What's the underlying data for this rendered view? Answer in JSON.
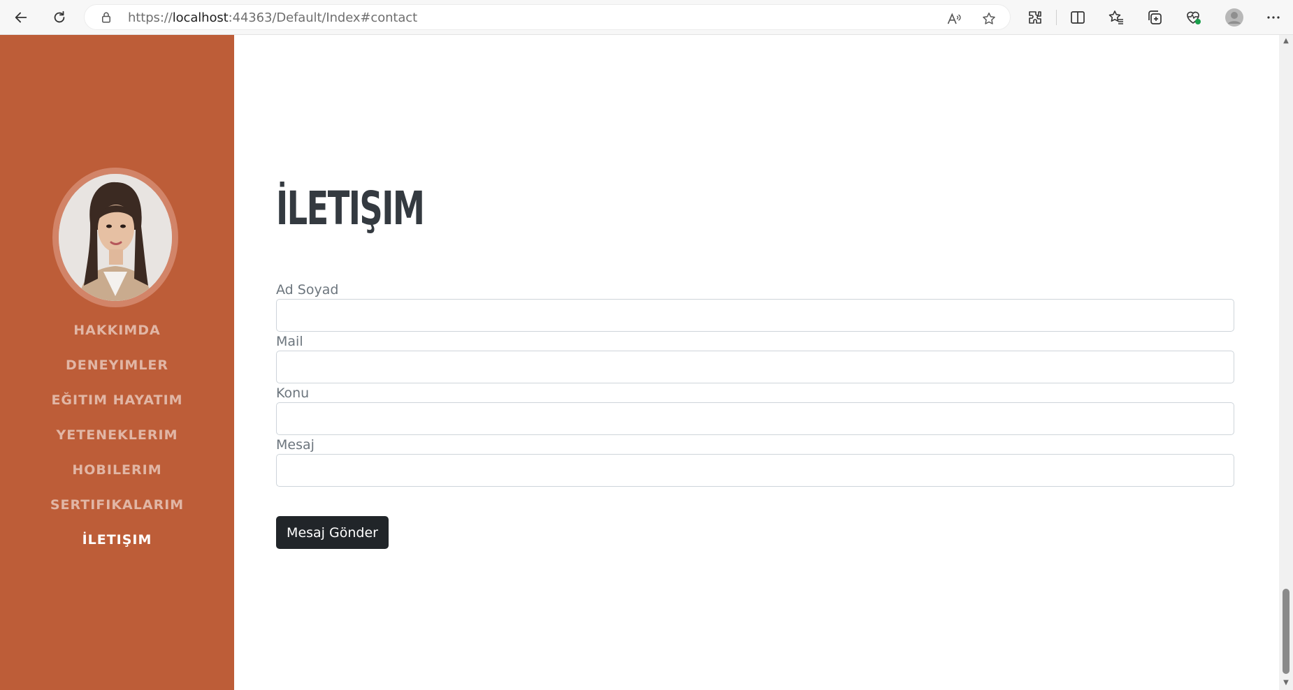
{
  "browser": {
    "url_prefix": "https://",
    "url_host": "localhost",
    "url_rest": ":44363/Default/Index#contact"
  },
  "sidebar": {
    "bg_color": "#bd5d38",
    "items": [
      {
        "label": "HAKKIMDA"
      },
      {
        "label": "DENEYIMLER"
      },
      {
        "label": "EĞITIM HAYATIM"
      },
      {
        "label": "YETENEKLERIM"
      },
      {
        "label": "HOBILERIM"
      },
      {
        "label": "SERTIFIKALARIM"
      },
      {
        "label": "İLETIŞIM"
      }
    ],
    "active_index": 6
  },
  "main": {
    "title": "İLETIŞIM",
    "form": {
      "fields": [
        {
          "label": "Ad Soyad",
          "value": ""
        },
        {
          "label": "Mail",
          "value": ""
        },
        {
          "label": "Konu",
          "value": ""
        },
        {
          "label": "Mesaj",
          "value": ""
        }
      ],
      "submit_label": "Mesaj Gönder"
    }
  }
}
